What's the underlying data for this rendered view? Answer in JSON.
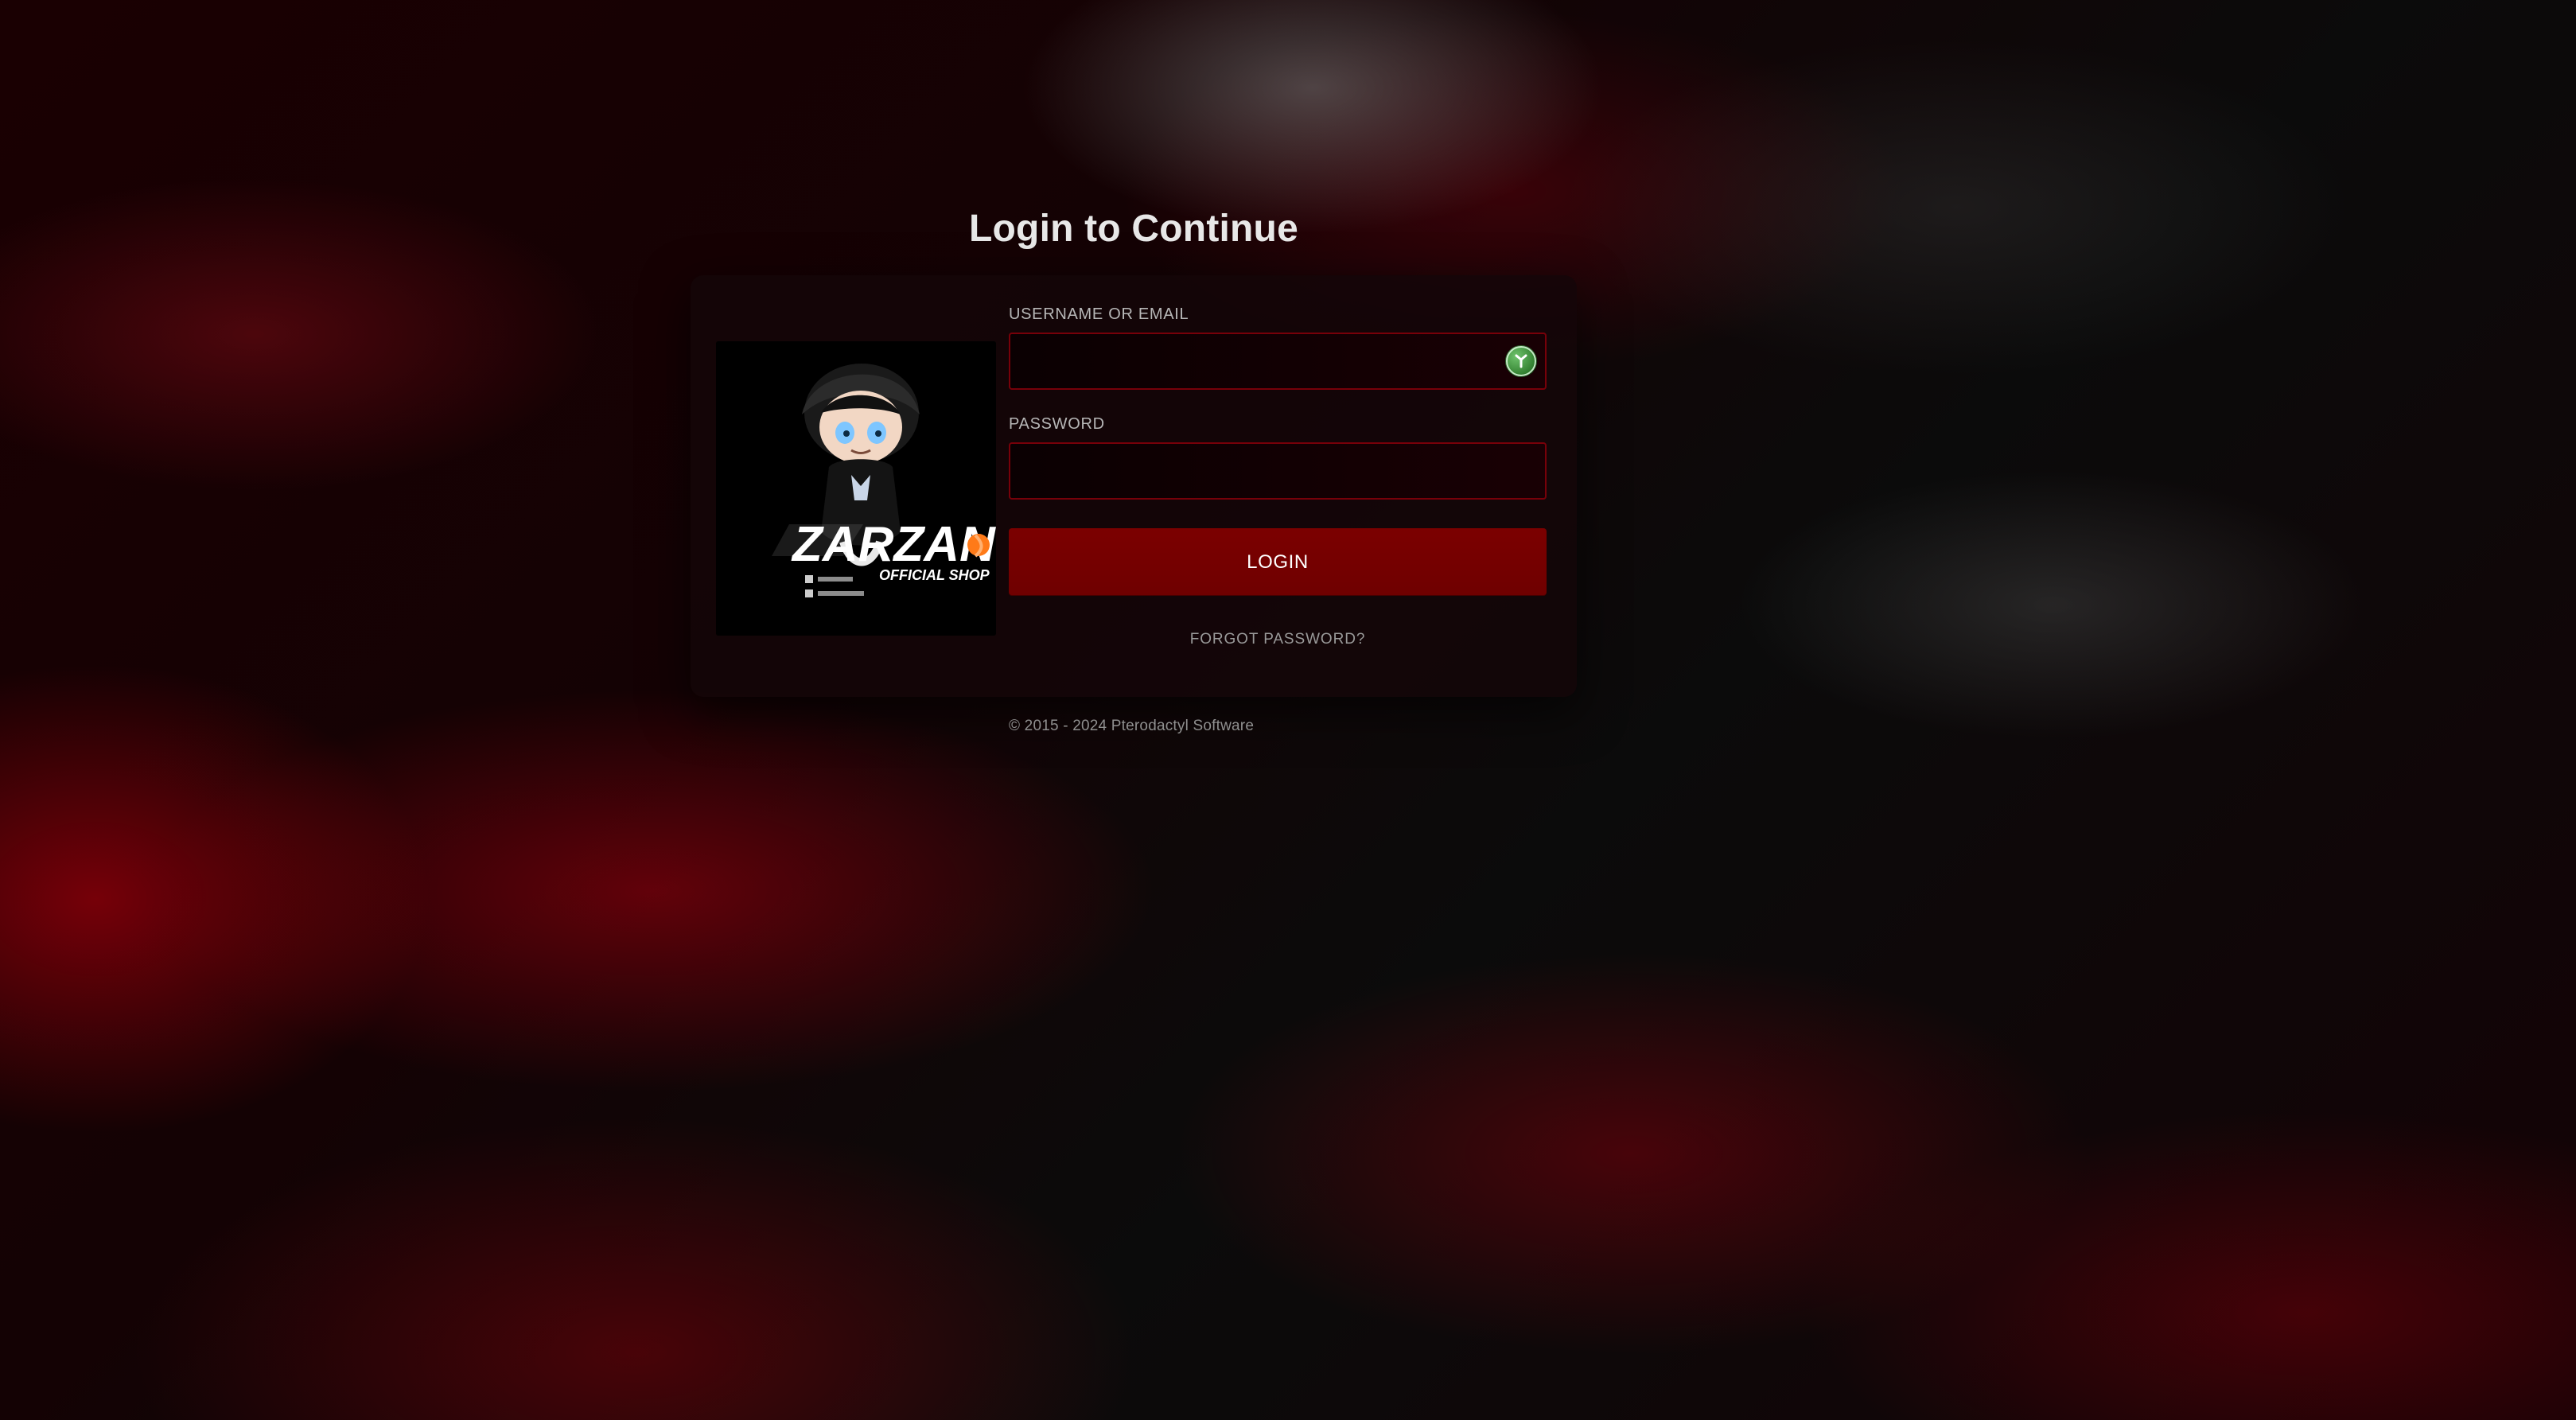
{
  "page": {
    "title": "Login to Continue"
  },
  "logo": {
    "brand_text": "ZARZAN",
    "tagline": "OFFICIAL SHOP"
  },
  "form": {
    "username_label": "USERNAME OR EMAIL",
    "password_label": "PASSWORD",
    "login_button": "LOGIN",
    "forgot_password": "FORGOT PASSWORD?"
  },
  "footer": {
    "text": "© 2015 - 2024 Pterodactyl Software"
  },
  "theme": {
    "accent": "#7b0000",
    "input_border": "#7d000a",
    "text": "#e8e8e8",
    "muted": "#9a9a9a"
  },
  "icons": {
    "username_field_badge": "password-manager-icon"
  }
}
